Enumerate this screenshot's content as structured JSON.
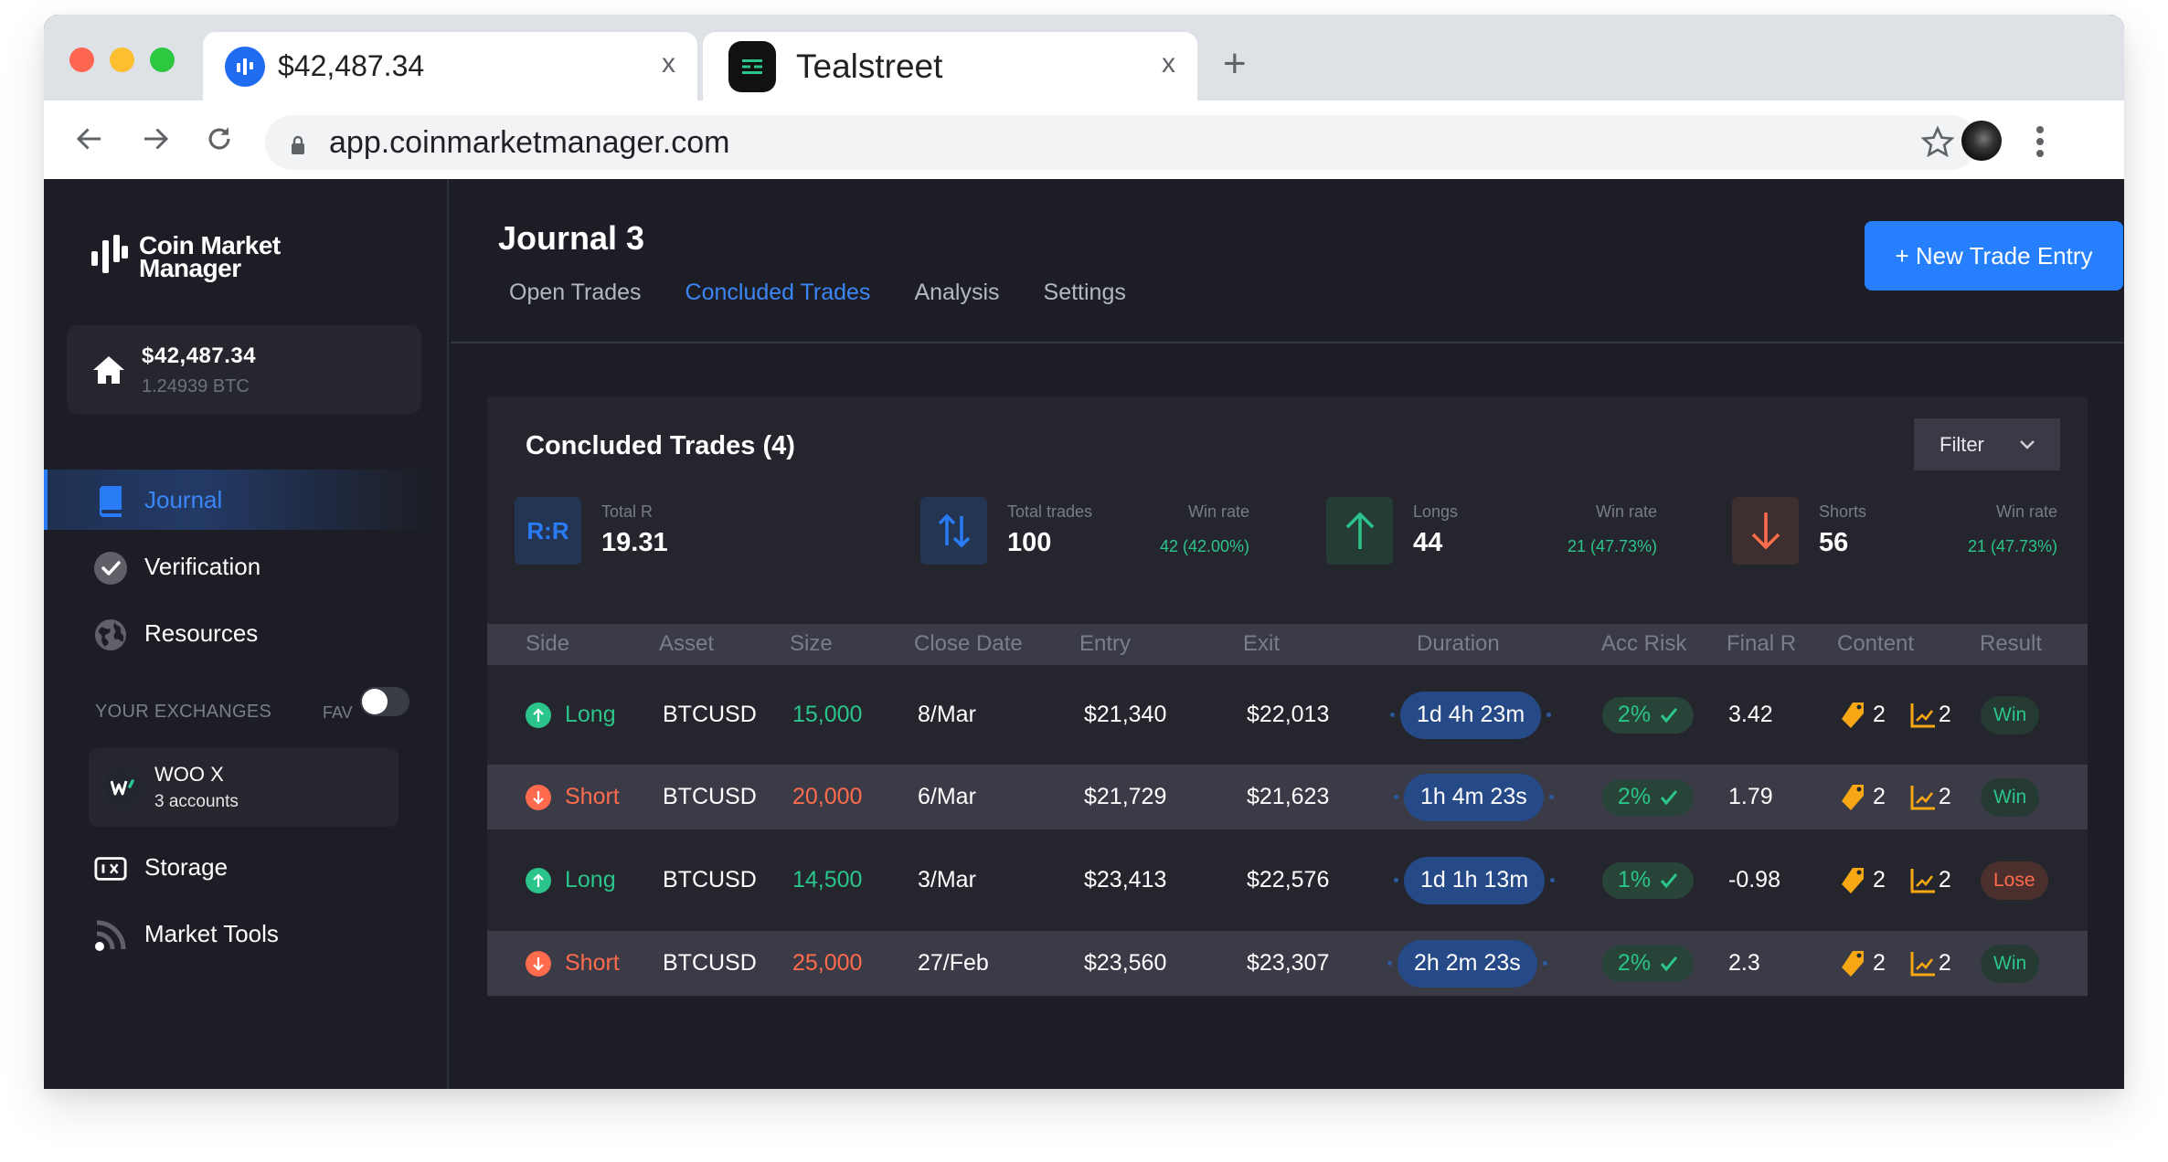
{
  "browser": {
    "tabs": [
      {
        "title": "$42,487.34",
        "icon": "coinmarketmanager-favicon",
        "close": "x"
      },
      {
        "title": "Tealstreet",
        "icon": "tealstreet-favicon",
        "close": "x"
      }
    ],
    "new_tab": "+",
    "url": "app.coinmarketmanager.com"
  },
  "sidebar": {
    "logo_line1": "Coin Market",
    "logo_line2": "Manager",
    "balance": {
      "usd": "$42,487.34",
      "btc": "1.24939 BTC"
    },
    "nav": [
      {
        "label": "Journal",
        "icon": "book-icon",
        "active": true
      },
      {
        "label": "Verification",
        "icon": "check-circle-icon",
        "active": false
      },
      {
        "label": "Resources",
        "icon": "globe-icon",
        "active": false
      }
    ],
    "exchanges_heading": "YOUR EXCHANGES",
    "fav_label": "FAV",
    "fav_enabled": false,
    "exchange": {
      "name": "WOO X",
      "accounts": "3 accounts"
    },
    "bottom_nav": [
      {
        "label": "Storage",
        "icon": "storage-icon"
      },
      {
        "label": "Market Tools",
        "icon": "rss-icon"
      }
    ]
  },
  "header": {
    "title": "Journal 3",
    "tabs": [
      {
        "label": "Open Trades",
        "active": false
      },
      {
        "label": "Concluded Trades",
        "active": true
      },
      {
        "label": "Analysis",
        "active": false
      },
      {
        "label": "Settings",
        "active": false
      }
    ],
    "new_trade_button": "+ New Trade Entry"
  },
  "panel": {
    "title": "Concluded Trades (4)",
    "filter_label": "Filter",
    "stats": {
      "total_r": {
        "icon_text": "R:R",
        "label": "Total R",
        "value": "19.31"
      },
      "total_trades": {
        "label": "Total trades",
        "value": "100",
        "win_rate_label": "Win rate",
        "win_rate": "42 (42.00%)"
      },
      "longs": {
        "label": "Longs",
        "value": "44",
        "win_rate_label": "Win rate",
        "win_rate": "21 (47.73%)"
      },
      "shorts": {
        "label": "Shorts",
        "value": "56",
        "win_rate_label": "Win rate",
        "win_rate": "21 (47.73%)"
      }
    },
    "columns": [
      "Side",
      "Asset",
      "Size",
      "Close Date",
      "Entry",
      "Exit",
      "Duration",
      "Acc Risk",
      "Final R",
      "Content",
      "Result"
    ],
    "rows": [
      {
        "side": "Long",
        "asset": "BTCUSD",
        "size": "15,000",
        "close_date": "8/Mar",
        "entry": "$21,340",
        "exit": "$22,013",
        "duration": "1d 4h 23m",
        "acc_risk": "2%",
        "final_r": "3.42",
        "tags": "2",
        "charts": "2",
        "result": "Win"
      },
      {
        "side": "Short",
        "asset": "BTCUSD",
        "size": "20,000",
        "close_date": "6/Mar",
        "entry": "$21,729",
        "exit": "$21,623",
        "duration": "1h 4m 23s",
        "acc_risk": "2%",
        "final_r": "1.79",
        "tags": "2",
        "charts": "2",
        "result": "Win"
      },
      {
        "side": "Long",
        "asset": "BTCUSD",
        "size": "14,500",
        "close_date": "3/Mar",
        "entry": "$23,413",
        "exit": "$22,576",
        "duration": "1d 1h 13m",
        "acc_risk": "1%",
        "final_r": "-0.98",
        "tags": "2",
        "charts": "2",
        "result": "Lose"
      },
      {
        "side": "Short",
        "asset": "BTCUSD",
        "size": "25,000",
        "close_date": "27/Feb",
        "entry": "$23,560",
        "exit": "$23,307",
        "duration": "2h 2m 23s",
        "acc_risk": "2%",
        "final_r": "2.3",
        "tags": "2",
        "charts": "2",
        "result": "Win"
      }
    ]
  },
  "colors": {
    "accent": "#2680fe",
    "long": "#2bc48a",
    "short": "#ff6b4d",
    "content_icon": "#f7a614",
    "duration_pill": "#254a87"
  }
}
